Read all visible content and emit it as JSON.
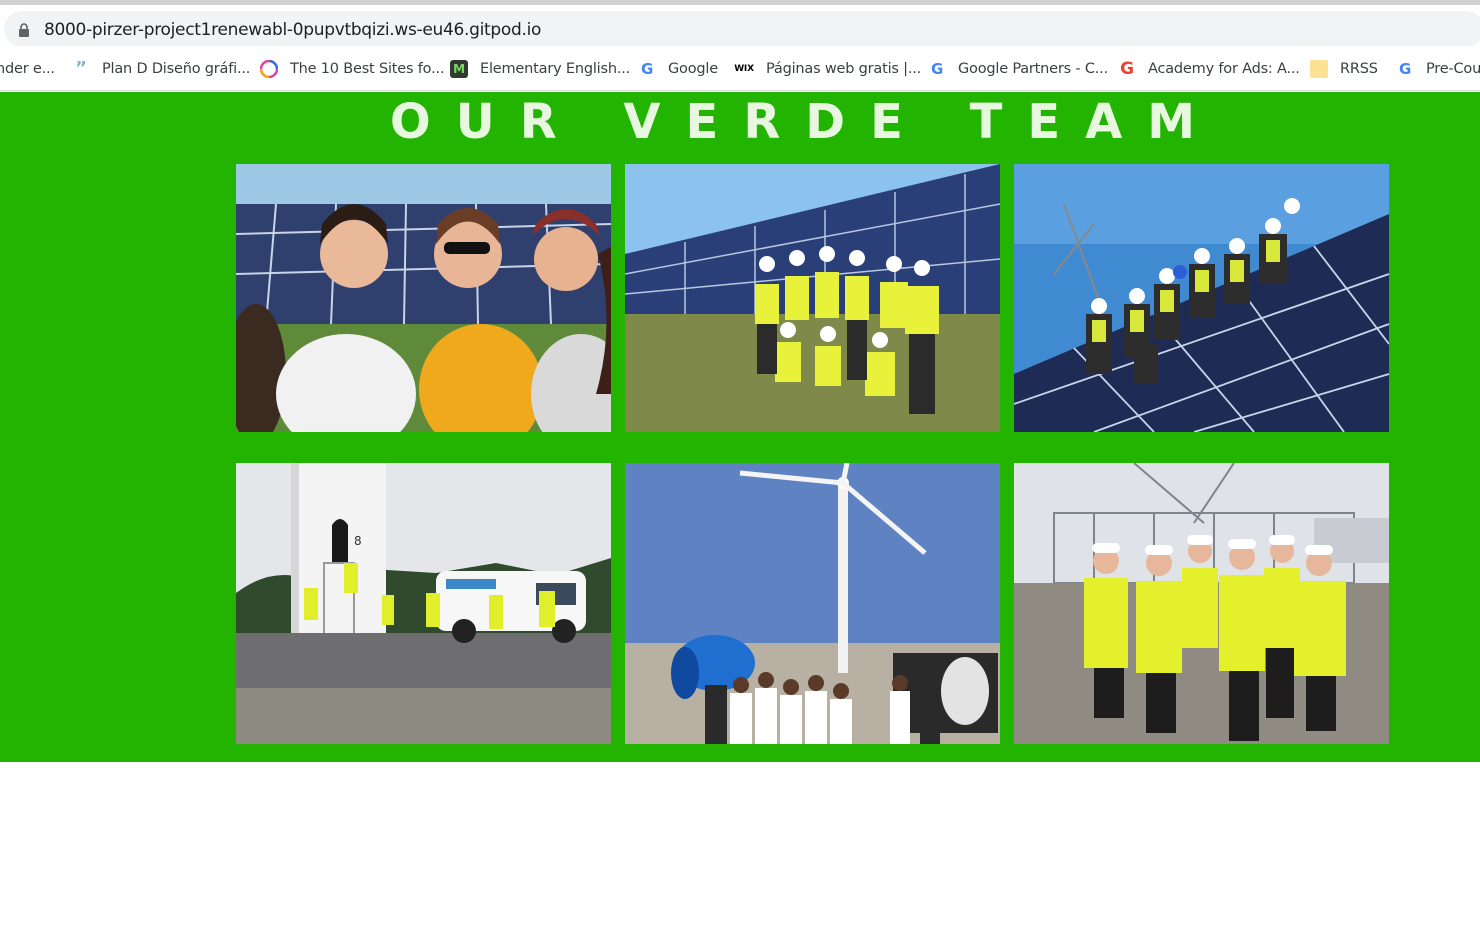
{
  "browser": {
    "url": "8000-pirzer-project1renewabl-0pupvtbqizi.ws-eu46.gitpod.io",
    "bookmarks": [
      {
        "label": "nder e...",
        "icon": "generic-page-icon"
      },
      {
        "label": "Plan D Diseño gráfi...",
        "icon": "quote-icon"
      },
      {
        "label": "The 10 Best Sites fo...",
        "icon": "colorful-circle-icon"
      },
      {
        "label": "Elementary English...",
        "icon": "m-logo-icon"
      },
      {
        "label": "Google",
        "icon": "google-g-icon"
      },
      {
        "label": "Páginas web gratis |...",
        "icon": "wix-logo-icon"
      },
      {
        "label": "Google Partners - C...",
        "icon": "google-g-icon"
      },
      {
        "label": "Academy for Ads: A...",
        "icon": "google-g-icon"
      },
      {
        "label": "RRSS",
        "icon": "folder-icon"
      },
      {
        "label": "Pre-Cour",
        "icon": "google-g-icon"
      }
    ]
  },
  "team": {
    "title": "OUR VERDE TEAM",
    "background": "#22b400",
    "photos": [
      {
        "subject": "Three women standing in front of solar panels"
      },
      {
        "subject": "Workers in hi-vis vests and hard hats posing by a solar array"
      },
      {
        "subject": "Crew in hard hats sitting on a sloped solar roof"
      },
      {
        "subject": "Workers at the base of a wind turbine tower next to a white van"
      },
      {
        "subject": "Students in white coats looking at a wind turbine"
      },
      {
        "subject": "Group in hi-vis jackets and hard hats at a construction site"
      }
    ]
  }
}
